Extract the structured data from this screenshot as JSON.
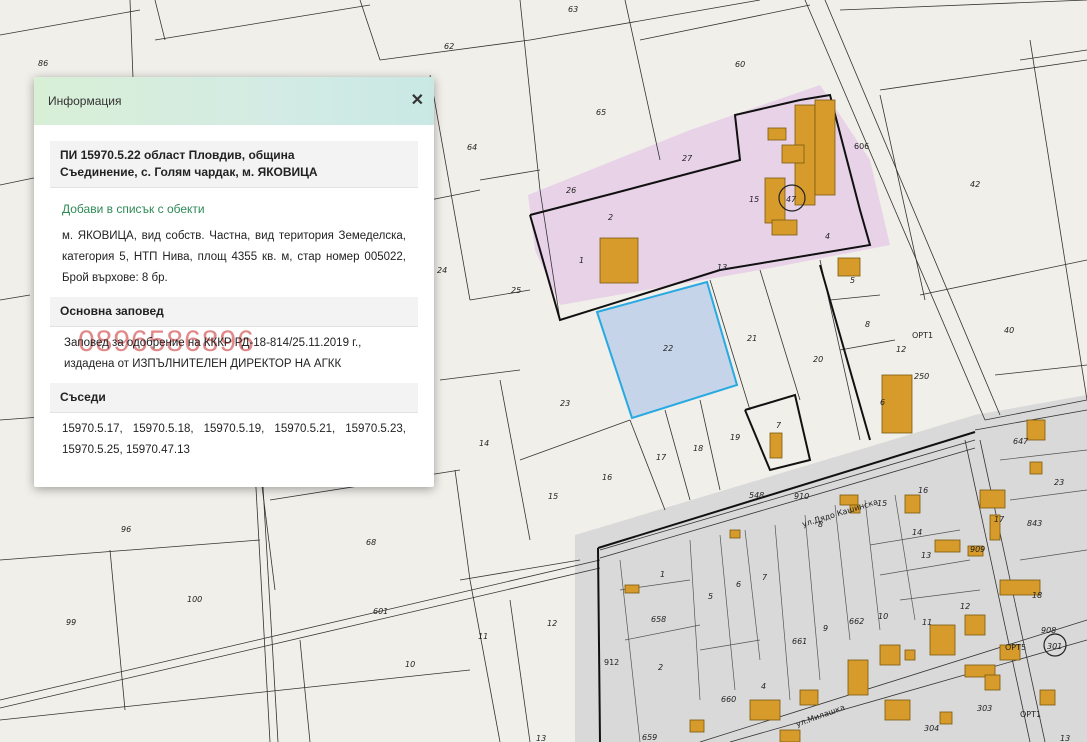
{
  "popup": {
    "title": "Информация",
    "close_symbol": "✕",
    "parcel_heading_line1": "ПИ 15970.5.22 област Пловдив, община",
    "parcel_heading_line2": "Съединение, с. Голям чардак, м. ЯКОВИЦА",
    "add_link": "Добави в списък с обекти",
    "description": "м. ЯКОВИЦА, вид собств. Частна, вид територия Земеделска, категория 5, НТП Нива, площ 4355 кв. м, стар номер 005022, Брой върхове: 8 бр.",
    "order_heading": "Основна заповед",
    "order_text": "Заповед за одобрение на КККР РД-18-814/25.11.2019 г., издадена от ИЗПЪЛНИТЕЛЕН ДИРЕКТОР НА АГКК",
    "watermark": "0896586896",
    "neighbors_heading": "Съседи",
    "neighbors": "15970.5.17, 15970.5.18, 15970.5.19, 15970.5.21, 15970.5.23, 15970.5.25, 15970.47.13"
  },
  "map": {
    "parcel_labels": [
      "86",
      "63",
      "62",
      "60",
      "65",
      "64",
      "27",
      "26",
      "2",
      "15",
      "47",
      "4",
      "1",
      "13",
      "5",
      "42",
      "25",
      "24",
      "22",
      "21",
      "20",
      "8",
      "40",
      "23",
      "14",
      "7",
      "19",
      "17",
      "18",
      "16",
      "15",
      "12",
      "250",
      "6",
      "647",
      "23",
      "96",
      "68",
      "601",
      "99",
      "100",
      "11",
      "12",
      "10",
      "13",
      "548",
      "910",
      "8",
      "15",
      "16",
      "14",
      "13",
      "1",
      "658",
      "5",
      "6",
      "7",
      "2",
      "661",
      "9",
      "662",
      "10",
      "11",
      "12",
      "909",
      "17",
      "18",
      "843",
      "908",
      "301",
      "660",
      "4",
      "304",
      "303",
      "659",
      "13"
    ],
    "road_numbers": [
      "606",
      "548",
      "910",
      "912",
      "601"
    ],
    "street_names": [
      "ул.Дядо Кашинска",
      "ул.Милашка"
    ],
    "survey_points": [
      "ОРТ1",
      "ОРТ5",
      "ОРТ1"
    ]
  },
  "colors": {
    "selected_fill": "#c6d4ea",
    "selected_stroke": "#27a9e1",
    "building": "#d69b2a",
    "zone": "#e6cde8",
    "urban": "#d9d9d9"
  }
}
